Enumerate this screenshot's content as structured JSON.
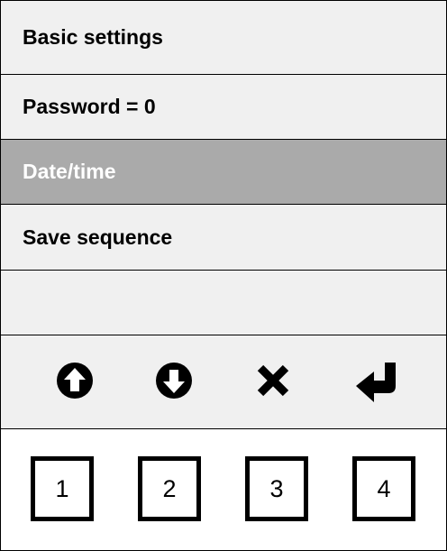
{
  "menu": {
    "items": [
      {
        "label": "Basic settings",
        "selected": false
      },
      {
        "label": "Password = 0",
        "selected": false
      },
      {
        "label": "Date/time",
        "selected": true
      },
      {
        "label": "Save sequence",
        "selected": false
      },
      {
        "label": "",
        "selected": false
      }
    ]
  },
  "toolbar": {
    "icons": [
      "arrow-up-circle-icon",
      "arrow-down-circle-icon",
      "close-icon",
      "enter-return-icon"
    ]
  },
  "keys": [
    "1",
    "2",
    "3",
    "4"
  ],
  "colors": {
    "row_background": "#f0f0f0",
    "selected_background": "#aaaaaa",
    "selected_text": "#ffffff",
    "border": "#000000"
  }
}
